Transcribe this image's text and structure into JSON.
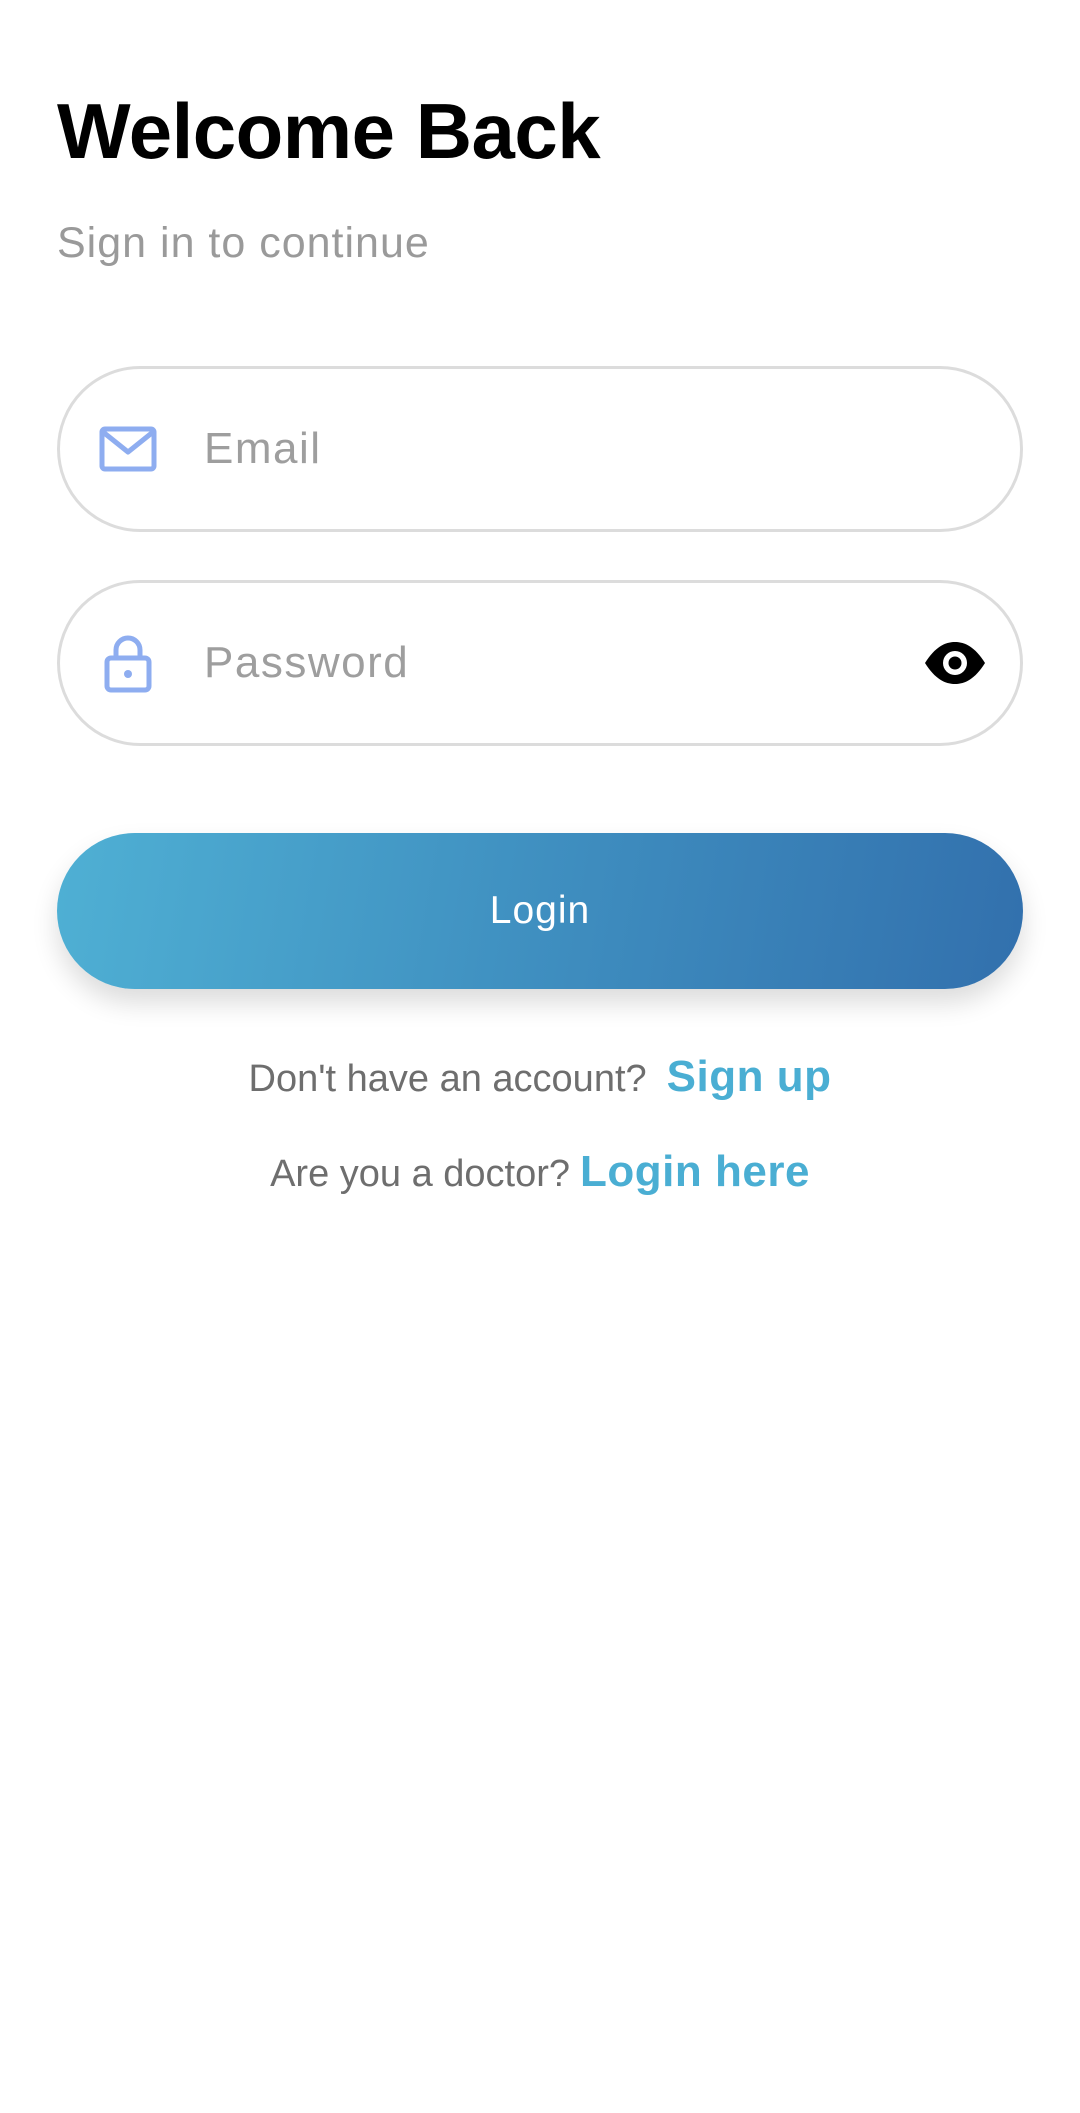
{
  "header": {
    "title": "Welcome Back",
    "subtitle": "Sign in to continue"
  },
  "form": {
    "email": {
      "placeholder": "Email",
      "value": "",
      "icon": "mail-icon"
    },
    "password": {
      "placeholder": "Password",
      "value": "",
      "icon": "lock-icon",
      "toggle_icon": "eye-icon"
    },
    "login_label": "Login"
  },
  "footer": {
    "signup_prompt": "Don't have an account?",
    "signup_link": "Sign up",
    "doctor_prompt": "Are you a doctor?",
    "doctor_link": "Login here"
  },
  "colors": {
    "icon_blue": "#8eadf0",
    "link_blue": "#4aaed3",
    "button_gradient_start": "#4fb0d4",
    "button_gradient_end": "#3270ad"
  }
}
